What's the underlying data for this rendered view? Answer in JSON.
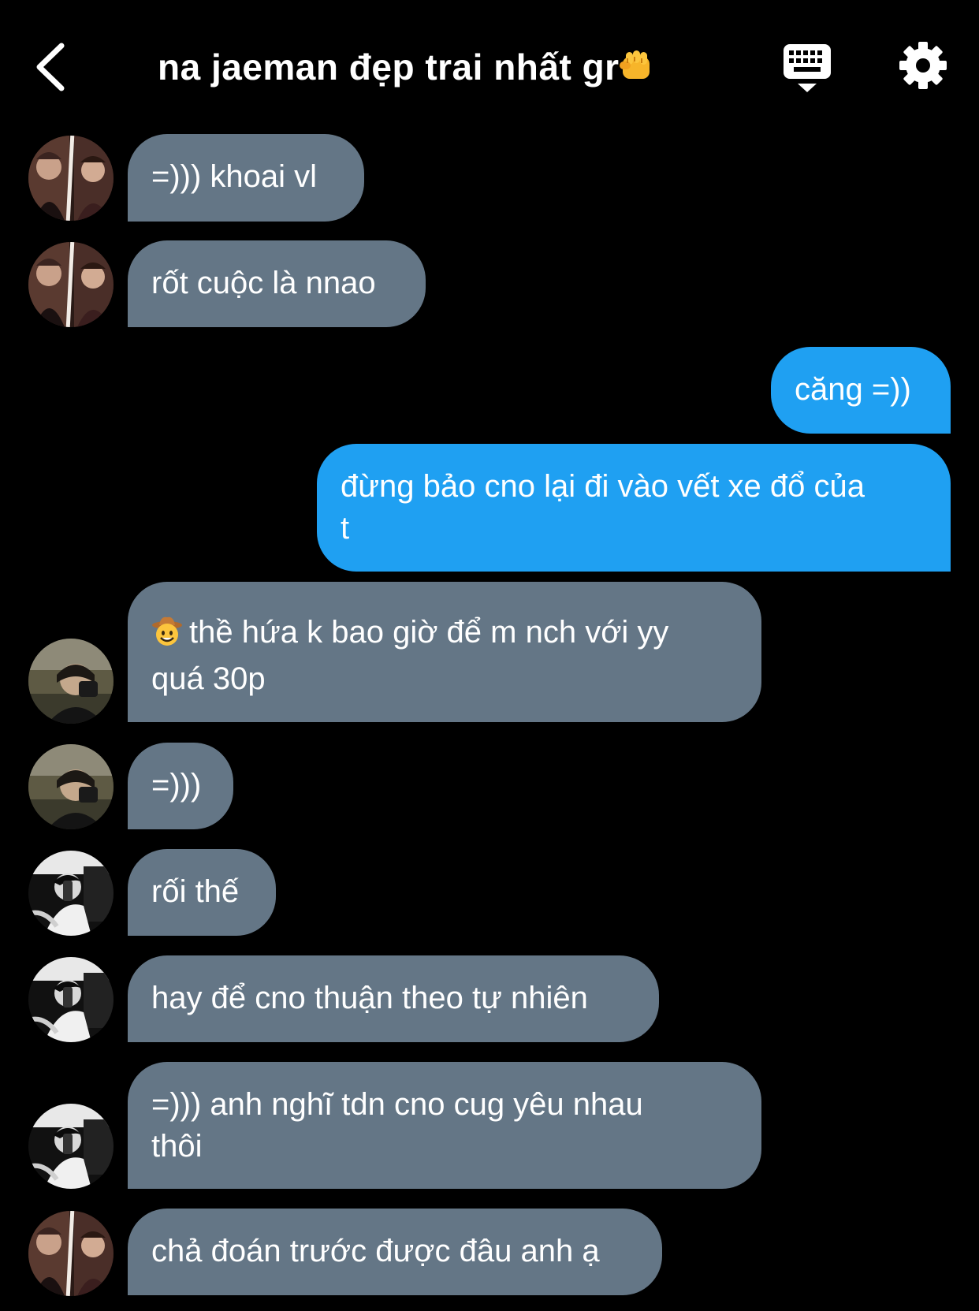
{
  "header": {
    "back_icon": "chevron-left-icon",
    "title": "na jaeman đẹp trai nhất gr",
    "title_emoji": "fist-emoji",
    "keyboard_icon": "keyboard-icon",
    "settings_icon": "gear-icon"
  },
  "colors": {
    "background": "#000000",
    "incoming_bubble": "#647686",
    "outgoing_bubble": "#1fa0f2",
    "text": "#ffffff"
  },
  "messages": [
    {
      "direction": "incoming",
      "sender_avatar": "avatar-a",
      "lines": [
        "=))) khoai vl"
      ]
    },
    {
      "direction": "incoming",
      "sender_avatar": "avatar-a",
      "lines": [
        "rốt cuộc là nnao"
      ]
    },
    {
      "direction": "outgoing",
      "lines": [
        "căng =))"
      ]
    },
    {
      "direction": "outgoing",
      "lines": [
        "đừng bảo cno lại đi vào vết xe đổ của",
        "t"
      ]
    },
    {
      "direction": "incoming",
      "sender_avatar": "avatar-b",
      "emoji": "cowboy-emoji",
      "lines": [
        "thề hứa k bao giờ để m nch với yy",
        "quá 30p"
      ]
    },
    {
      "direction": "incoming",
      "sender_avatar": "avatar-b",
      "lines": [
        "=)))"
      ]
    },
    {
      "direction": "incoming",
      "sender_avatar": "avatar-c",
      "lines": [
        "rối thế"
      ]
    },
    {
      "direction": "incoming",
      "sender_avatar": "avatar-c",
      "lines": [
        "hay để cno thuận theo tự nhiên"
      ]
    },
    {
      "direction": "incoming",
      "sender_avatar": "avatar-c",
      "lines": [
        "=))) anh nghĩ tdn cno cug yêu nhau",
        "thôi"
      ]
    },
    {
      "direction": "incoming",
      "sender_avatar": "avatar-a",
      "lines": [
        "chả đoán trước được đâu anh ạ"
      ]
    }
  ]
}
